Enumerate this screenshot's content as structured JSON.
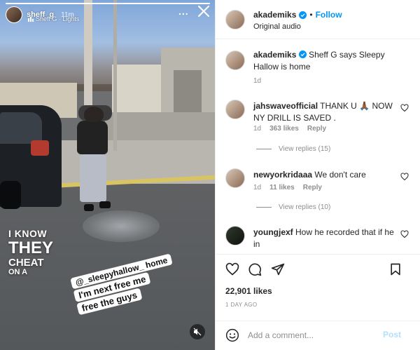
{
  "story": {
    "username": "sheff_g",
    "time": "11m",
    "music": "Sheff G · Lights",
    "more": "...",
    "overlay_lines": [
      "I KNOW",
      "THEY",
      "CHEAT",
      "ON A"
    ],
    "sticker_mention": "@_sleepyhallow_ home",
    "sticker_line2": "I'm next free me",
    "sticker_line3": "free the guys"
  },
  "post": {
    "author": "akademiks",
    "follow_label": "Follow",
    "audio": "Original audio",
    "caption_user": "akademiks",
    "caption_text": "Sheff G says Sleepy Hallow is home",
    "caption_time": "1d",
    "likes": "22,901 likes",
    "date": "1 DAY AGO"
  },
  "comments": [
    {
      "user": "jahswaveofficial",
      "text": "THANK U 🙏🏾 NOW NY DRILL IS SAVED .",
      "time": "1d",
      "likes": "363 likes",
      "reply_label": "Reply",
      "view_replies": "View replies (15)"
    },
    {
      "user": "newyorkridaaa",
      "text": "We don't care",
      "time": "1d",
      "likes": "11 likes",
      "reply_label": "Reply",
      "view_replies": "View replies (10)"
    },
    {
      "user": "youngjexf",
      "text": "How he recorded that if he in"
    }
  ],
  "comment_box": {
    "placeholder": "Add a comment...",
    "post_label": "Post"
  },
  "colors": {
    "link_blue": "#0095f6",
    "post_disabled": "#b2dffc",
    "muted_text": "#8e8e8e"
  }
}
